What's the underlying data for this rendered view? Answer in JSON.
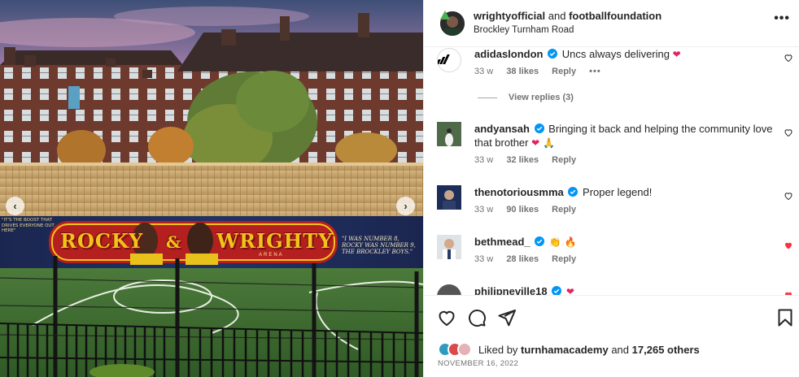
{
  "post": {
    "author": "wrightyofficial",
    "connector": "and",
    "collaborator": "footballfoundation",
    "location": "Brockley Turnham Road",
    "more_icon": "more-horizontal-icon"
  },
  "media": {
    "prev_icon": "chevron-left-icon",
    "next_icon": "chevron-right-icon",
    "mural": {
      "name_left": "ROCKY",
      "ampersand": "&",
      "name_right": "WRIGHTY",
      "arena": "ARENA",
      "quote_right": "\"I WAS NUMBER 8, ROCKY WAS NUMBER 9, THE BROCKLEY BOYS.\"",
      "quote_left": "\"IT'S THE BOOST THAT DRIVES EVERYONE OUT HERE\""
    }
  },
  "comments": [
    {
      "username": "adidaslondon",
      "verified": true,
      "text": "Uncs always delivering",
      "emoji": "❤",
      "age": "33 w",
      "likes": "38 likes",
      "reply": "Reply",
      "more": "•••",
      "liked": false,
      "view_replies": "View replies (3)"
    },
    {
      "username": "andyansah",
      "verified": true,
      "text": "Bringing it back and helping the community love that brother",
      "emoji": "❤ 🙏",
      "age": "33 w",
      "likes": "32 likes",
      "reply": "Reply",
      "liked": false
    },
    {
      "username": "thenotoriousmma",
      "verified": true,
      "text": "Proper legend!",
      "emoji": "",
      "age": "33 w",
      "likes": "90 likes",
      "reply": "Reply",
      "liked": false
    },
    {
      "username": "bethmead_",
      "verified": true,
      "text": "",
      "emoji": "👏 🔥",
      "age": "33 w",
      "likes": "28 likes",
      "reply": "Reply",
      "liked": true
    },
    {
      "username": "philipneville18",
      "verified": true,
      "text": "",
      "emoji": "❤",
      "liked": true
    }
  ],
  "actions": {
    "like_icon": "heart-outline-icon",
    "comment_icon": "comment-icon",
    "share_icon": "send-icon",
    "save_icon": "bookmark-icon"
  },
  "likes_summary": {
    "prefix": "Liked by",
    "user": "turnhamacademy",
    "connector": "and",
    "others": "17,265 others"
  },
  "date": "NOVEMBER 16, 2022",
  "colors": {
    "heart_red": "#ff3040",
    "verified_blue": "#0095f6",
    "meta_gray": "#737373"
  }
}
